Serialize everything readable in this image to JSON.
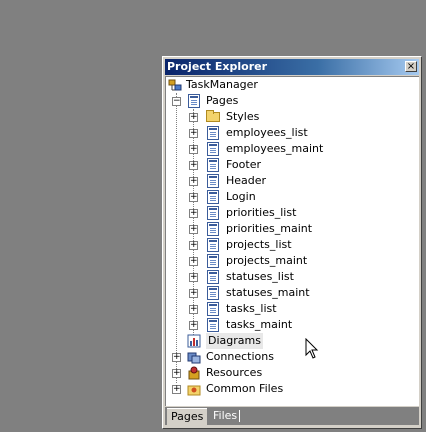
{
  "panel": {
    "title": "Project Explorer",
    "close_glyph": "×"
  },
  "tree": {
    "root": "TaskManager",
    "pages_node": "Pages",
    "pages": [
      {
        "label": "Styles",
        "icon": "folder-icon"
      },
      {
        "label": "employees_list",
        "icon": "page-icon"
      },
      {
        "label": "employees_maint",
        "icon": "page-icon"
      },
      {
        "label": "Footer",
        "icon": "page-icon"
      },
      {
        "label": "Header",
        "icon": "page-icon"
      },
      {
        "label": "Login",
        "icon": "page-icon"
      },
      {
        "label": "priorities_list",
        "icon": "page-icon"
      },
      {
        "label": "priorities_maint",
        "icon": "page-icon"
      },
      {
        "label": "projects_list",
        "icon": "page-icon"
      },
      {
        "label": "projects_maint",
        "icon": "page-icon"
      },
      {
        "label": "statuses_list",
        "icon": "page-icon"
      },
      {
        "label": "statuses_maint",
        "icon": "page-icon"
      },
      {
        "label": "tasks_list",
        "icon": "page-icon"
      },
      {
        "label": "tasks_maint",
        "icon": "page-icon"
      }
    ],
    "diagrams": "Diagrams",
    "connections": "Connections",
    "resources": "Resources",
    "common_files": "Common Files"
  },
  "tabs": {
    "pages": "Pages",
    "files": "Files"
  },
  "colors": {
    "titlebar_start": "#0a246a",
    "titlebar_end": "#a6caf0",
    "background": "#808080"
  }
}
